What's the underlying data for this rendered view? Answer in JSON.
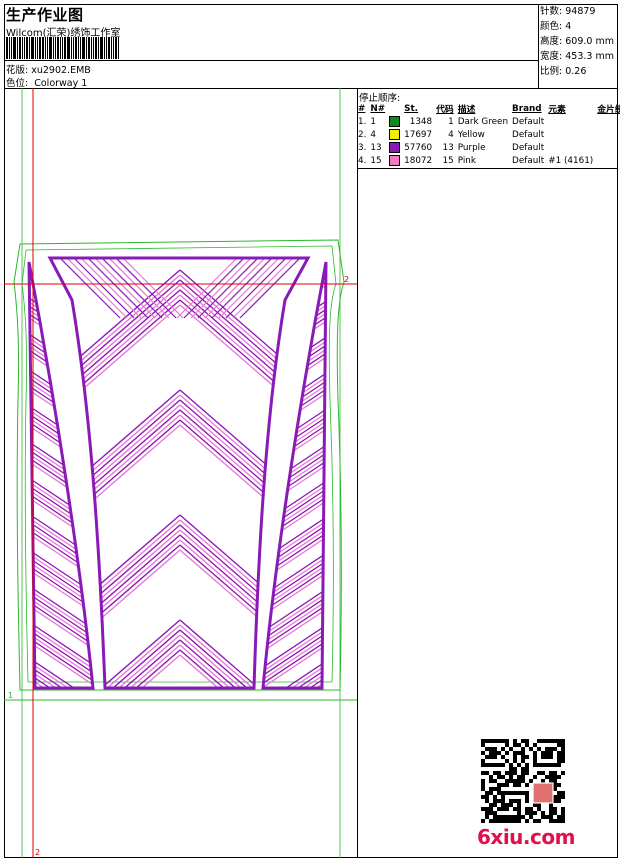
{
  "header": {
    "title": "生产作业图",
    "company": "Wilcom(汇荣)绣饰工作室",
    "design_label": "花版:",
    "design_value": "xu2902.EMB",
    "color_label": "色位:",
    "color_value": "Colorway 1"
  },
  "stats": {
    "stitches_label": "针数:",
    "stitches": "94879",
    "colors_label": "颜色:",
    "colors": "4",
    "height_label": "高度:",
    "height": "609.0 mm",
    "width_label": "宽度:",
    "width": "453.3 mm",
    "scale_label": "比例:",
    "scale": "0.26"
  },
  "stop_sequence": {
    "title": "停止顺序:",
    "headers": [
      "#",
      "N#",
      "St.",
      "代码",
      "描述",
      "Brand",
      "元素",
      "金片绣"
    ],
    "rows": [
      {
        "num": "1.",
        "n": "1",
        "st": "1348",
        "code": "1",
        "desc": "Dark Green",
        "brand": "Default",
        "element": "",
        "sequin": "",
        "color": "#0f8a1f"
      },
      {
        "num": "2.",
        "n": "4",
        "st": "17697",
        "code": "4",
        "desc": "Yellow",
        "brand": "Default",
        "element": "",
        "sequin": "",
        "color": "#f0f000"
      },
      {
        "num": "3.",
        "n": "13",
        "st": "57760",
        "code": "13",
        "desc": "Purple",
        "brand": "Default",
        "element": "",
        "sequin": "",
        "color": "#8a1ab8"
      },
      {
        "num": "4.",
        "n": "15",
        "st": "18072",
        "code": "15",
        "desc": "Pink",
        "brand": "Default",
        "element": "#1 (4161)",
        "sequin": "",
        "color": "#f07ac0"
      }
    ]
  },
  "canvas": {
    "marker_1": "1",
    "marker_2": "2",
    "marker_2b": "2"
  },
  "colors": {
    "purple": "#8a1ab8",
    "pink": "#e87ad0",
    "green": "#2db82d",
    "red": "#e00000"
  },
  "watermark": {
    "text": "6xiu.com",
    "qr": "qr-code"
  }
}
